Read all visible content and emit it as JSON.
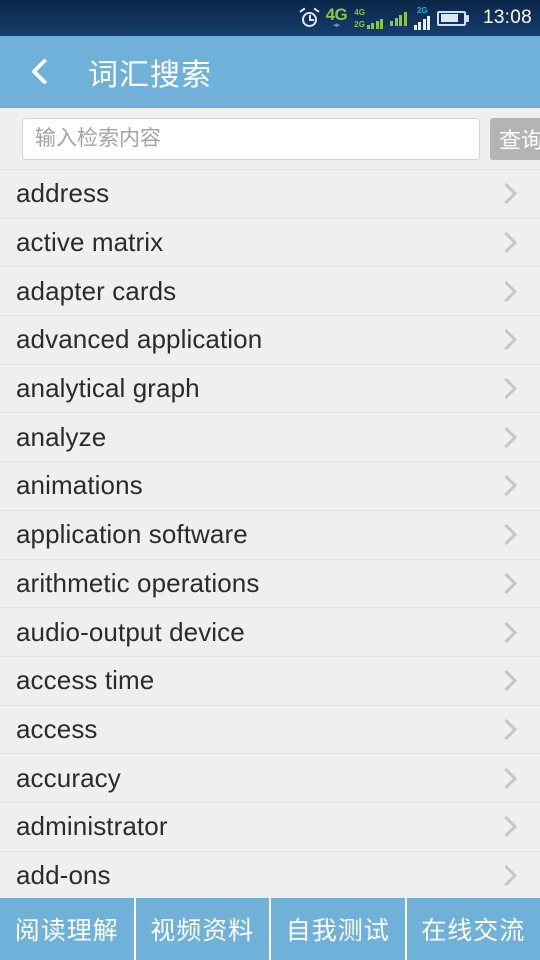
{
  "statusbar": {
    "alarm_icon": "alarm-clock-icon",
    "network_label": "4G",
    "sim1_top_label": "4G",
    "sim1_bottom_label": "2G",
    "sim2_label": "2G",
    "battery_icon": "battery-icon",
    "clock": "13:08"
  },
  "header": {
    "back_icon": "chevron-left-icon",
    "title": "词汇搜索"
  },
  "search": {
    "placeholder": "输入检索内容",
    "value": "",
    "button_label": "查询"
  },
  "list": {
    "items": [
      {
        "label": "address"
      },
      {
        "label": "active matrix"
      },
      {
        "label": "adapter cards"
      },
      {
        "label": "advanced application"
      },
      {
        "label": "analytical graph"
      },
      {
        "label": "analyze"
      },
      {
        "label": "animations"
      },
      {
        "label": "application software"
      },
      {
        "label": "arithmetic operations"
      },
      {
        "label": "audio-output device"
      },
      {
        "label": "access time"
      },
      {
        "label": "access"
      },
      {
        "label": "accuracy"
      },
      {
        "label": "administrator"
      },
      {
        "label": "add-ons"
      }
    ]
  },
  "tabbar": {
    "tabs": [
      {
        "label": "阅读理解"
      },
      {
        "label": "视频资料"
      },
      {
        "label": "自我测试"
      },
      {
        "label": "在线交流"
      }
    ]
  },
  "colors": {
    "statusbar_bg": "#10325C",
    "header_bg": "#6FB1D9",
    "list_bg": "#EFEFEF",
    "row_divider": "#E3E3E3",
    "chevron": "#C6C6C6",
    "search_button_bg": "#B4B4B4",
    "tab_bg": "#6FB1D9",
    "signal_green": "#8BC63E",
    "signal_blue": "#2EA8E0"
  }
}
